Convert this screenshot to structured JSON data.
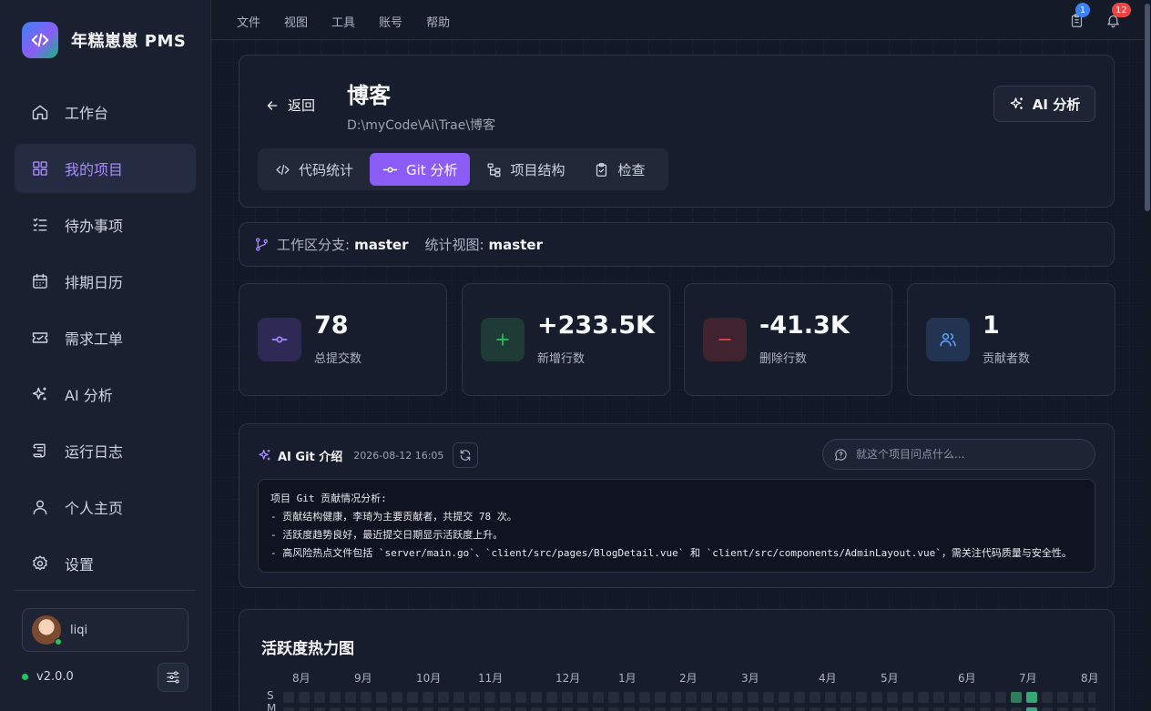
{
  "app": {
    "name": "年糕崽崽 PMS",
    "version": "v2.0.0"
  },
  "sidebar": {
    "items": [
      {
        "label": "工作台",
        "icon": "home-icon",
        "active": false
      },
      {
        "label": "我的项目",
        "icon": "grid-icon",
        "active": true
      },
      {
        "label": "待办事项",
        "icon": "checklist-icon",
        "active": false
      },
      {
        "label": "排期日历",
        "icon": "calendar-icon",
        "active": false
      },
      {
        "label": "需求工单",
        "icon": "ticket-icon",
        "active": false
      },
      {
        "label": "AI 分析",
        "icon": "sparkles-icon",
        "active": false
      },
      {
        "label": "运行日志",
        "icon": "scroll-icon",
        "active": false
      },
      {
        "label": "个人主页",
        "icon": "user-icon",
        "active": false
      },
      {
        "label": "设置",
        "icon": "gear-icon",
        "active": false
      }
    ],
    "user": {
      "name": "liqi"
    }
  },
  "topbar": {
    "menu": [
      "文件",
      "视图",
      "工具",
      "账号",
      "帮助"
    ],
    "clipboard_badge": "1",
    "bell_badge": "12"
  },
  "project": {
    "back_label": "返回",
    "title": "博客",
    "path": "D:\\myCode\\Ai\\Trae\\博客",
    "ai_button": "AI 分析",
    "tabs": [
      {
        "label": "代码统计",
        "icon": "code-icon",
        "active": false
      },
      {
        "label": "Git 分析",
        "icon": "git-commit-icon",
        "active": true
      },
      {
        "label": "项目结构",
        "icon": "tree-icon",
        "active": false
      },
      {
        "label": "检查",
        "icon": "clipboard-check-icon",
        "active": false
      }
    ]
  },
  "branch": {
    "workspace_label": "工作区分支:",
    "workspace_value": "master",
    "view_label": "统计视图:",
    "view_value": "master"
  },
  "stats": [
    {
      "value": "78",
      "label": "总提交数",
      "icon": "git-commit-icon",
      "color": "#8b5cf6"
    },
    {
      "value": "+233.5K",
      "label": "新增行数",
      "icon": "plus-icon",
      "color": "#22c55e"
    },
    {
      "value": "-41.3K",
      "label": "删除行数",
      "icon": "minus-icon",
      "color": "#ef4444"
    },
    {
      "value": "1",
      "label": "贡献者数",
      "icon": "users-icon",
      "color": "#60a5fa"
    }
  ],
  "ai_intro": {
    "title": "AI Git 介绍",
    "date": "2026-08-12 16:05",
    "placeholder": "就这个项目问点什么...",
    "lines": [
      "项目 Git 贡献情况分析:",
      "- 贡献结构健康，李琦为主要贡献者，共提交 78 次。",
      "- 活跃度趋势良好，最近提交日期显示活跃度上升。",
      "- 高风险热点文件包括 `server/main.go`、`client/src/pages/BlogDetail.vue` 和 `client/src/components/AdminLayout.vue`，需关注代码质量与安全性。"
    ]
  },
  "heatmap": {
    "title": "活跃度热力图",
    "months": [
      "8月",
      "9月",
      "10月",
      "11月",
      "12月",
      "1月",
      "2月",
      "3月",
      "4月",
      "5月",
      "6月",
      "7月",
      "8月"
    ],
    "day_labels": [
      "S",
      "M"
    ],
    "active_weeks": [
      {
        "week": 47,
        "day": 0,
        "level": 2
      },
      {
        "week": 48,
        "day": 0,
        "level": 3
      },
      {
        "week": 48,
        "day": 1,
        "level": 3
      }
    ],
    "colors": {
      "empty": "#262c3a",
      "level2": "#2f7d5b",
      "level3": "#3aa676"
    }
  }
}
